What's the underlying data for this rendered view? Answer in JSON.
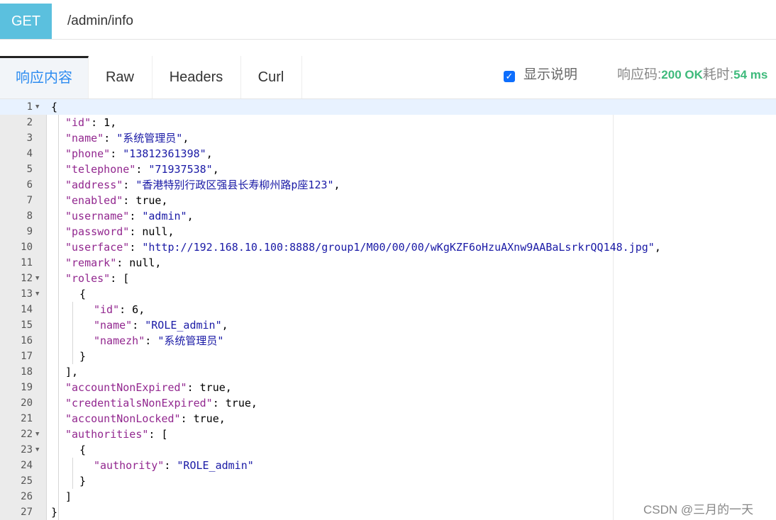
{
  "request": {
    "method": "GET",
    "url": "/admin/info"
  },
  "tabs": [
    "响应内容",
    "Raw",
    "Headers",
    "Curl"
  ],
  "options": {
    "show_desc_label": "显示说明",
    "show_desc_checked": true
  },
  "status": {
    "code_label": "响应码:",
    "code_value": "200 OK",
    "time_label": "耗时:",
    "time_value": "54 ms"
  },
  "editor": {
    "lines": [
      {
        "n": "1",
        "fold": true,
        "indent": 0,
        "parts": [
          {
            "t": "{",
            "c": "b"
          }
        ]
      },
      {
        "n": "2",
        "fold": false,
        "indent": 1,
        "parts": [
          {
            "t": "\"id\"",
            "c": "k"
          },
          {
            "t": ": 1,",
            "c": "b"
          }
        ]
      },
      {
        "n": "3",
        "fold": false,
        "indent": 1,
        "parts": [
          {
            "t": "\"name\"",
            "c": "k"
          },
          {
            "t": ": ",
            "c": "b"
          },
          {
            "t": "\"系统管理员\"",
            "c": "s"
          },
          {
            "t": ",",
            "c": "b"
          }
        ]
      },
      {
        "n": "4",
        "fold": false,
        "indent": 1,
        "parts": [
          {
            "t": "\"phone\"",
            "c": "k"
          },
          {
            "t": ": ",
            "c": "b"
          },
          {
            "t": "\"13812361398\"",
            "c": "s"
          },
          {
            "t": ",",
            "c": "b"
          }
        ]
      },
      {
        "n": "5",
        "fold": false,
        "indent": 1,
        "parts": [
          {
            "t": "\"telephone\"",
            "c": "k"
          },
          {
            "t": ": ",
            "c": "b"
          },
          {
            "t": "\"71937538\"",
            "c": "s"
          },
          {
            "t": ",",
            "c": "b"
          }
        ]
      },
      {
        "n": "6",
        "fold": false,
        "indent": 1,
        "parts": [
          {
            "t": "\"address\"",
            "c": "k"
          },
          {
            "t": ": ",
            "c": "b"
          },
          {
            "t": "\"香港特别行政区强县长寿柳州路p座123\"",
            "c": "s"
          },
          {
            "t": ",",
            "c": "b"
          }
        ]
      },
      {
        "n": "7",
        "fold": false,
        "indent": 1,
        "parts": [
          {
            "t": "\"enabled\"",
            "c": "k"
          },
          {
            "t": ": true,",
            "c": "b"
          }
        ]
      },
      {
        "n": "8",
        "fold": false,
        "indent": 1,
        "parts": [
          {
            "t": "\"username\"",
            "c": "k"
          },
          {
            "t": ": ",
            "c": "b"
          },
          {
            "t": "\"admin\"",
            "c": "s"
          },
          {
            "t": ",",
            "c": "b"
          }
        ]
      },
      {
        "n": "9",
        "fold": false,
        "indent": 1,
        "parts": [
          {
            "t": "\"password\"",
            "c": "k"
          },
          {
            "t": ": null,",
            "c": "b"
          }
        ]
      },
      {
        "n": "10",
        "fold": false,
        "indent": 1,
        "parts": [
          {
            "t": "\"userface\"",
            "c": "k"
          },
          {
            "t": ": ",
            "c": "b"
          },
          {
            "t": "\"http://192.168.10.100:8888/group1/M00/00/00/wKgKZF6oHzuAXnw9AABaLsrkrQQ148.jpg\"",
            "c": "s"
          },
          {
            "t": ",",
            "c": "b"
          }
        ]
      },
      {
        "n": "11",
        "fold": false,
        "indent": 1,
        "parts": [
          {
            "t": "\"remark\"",
            "c": "k"
          },
          {
            "t": ": null,",
            "c": "b"
          }
        ]
      },
      {
        "n": "12",
        "fold": true,
        "indent": 1,
        "parts": [
          {
            "t": "\"roles\"",
            "c": "k"
          },
          {
            "t": ": [",
            "c": "b"
          }
        ]
      },
      {
        "n": "13",
        "fold": true,
        "indent": 2,
        "parts": [
          {
            "t": "{",
            "c": "b"
          }
        ]
      },
      {
        "n": "14",
        "fold": false,
        "indent": 3,
        "parts": [
          {
            "t": "\"id\"",
            "c": "k"
          },
          {
            "t": ": 6,",
            "c": "b"
          }
        ]
      },
      {
        "n": "15",
        "fold": false,
        "indent": 3,
        "parts": [
          {
            "t": "\"name\"",
            "c": "k"
          },
          {
            "t": ": ",
            "c": "b"
          },
          {
            "t": "\"ROLE_admin\"",
            "c": "s"
          },
          {
            "t": ",",
            "c": "b"
          }
        ]
      },
      {
        "n": "16",
        "fold": false,
        "indent": 3,
        "parts": [
          {
            "t": "\"namezh\"",
            "c": "k"
          },
          {
            "t": ": ",
            "c": "b"
          },
          {
            "t": "\"系统管理员\"",
            "c": "s"
          }
        ]
      },
      {
        "n": "17",
        "fold": false,
        "indent": 2,
        "parts": [
          {
            "t": "}",
            "c": "b"
          }
        ]
      },
      {
        "n": "18",
        "fold": false,
        "indent": 1,
        "parts": [
          {
            "t": "],",
            "c": "b"
          }
        ]
      },
      {
        "n": "19",
        "fold": false,
        "indent": 1,
        "parts": [
          {
            "t": "\"accountNonExpired\"",
            "c": "k"
          },
          {
            "t": ": true,",
            "c": "b"
          }
        ]
      },
      {
        "n": "20",
        "fold": false,
        "indent": 1,
        "parts": [
          {
            "t": "\"credentialsNonExpired\"",
            "c": "k"
          },
          {
            "t": ": true,",
            "c": "b"
          }
        ]
      },
      {
        "n": "21",
        "fold": false,
        "indent": 1,
        "parts": [
          {
            "t": "\"accountNonLocked\"",
            "c": "k"
          },
          {
            "t": ": true,",
            "c": "b"
          }
        ]
      },
      {
        "n": "22",
        "fold": true,
        "indent": 1,
        "parts": [
          {
            "t": "\"authorities\"",
            "c": "k"
          },
          {
            "t": ": [",
            "c": "b"
          }
        ]
      },
      {
        "n": "23",
        "fold": true,
        "indent": 2,
        "parts": [
          {
            "t": "{",
            "c": "b"
          }
        ]
      },
      {
        "n": "24",
        "fold": false,
        "indent": 3,
        "parts": [
          {
            "t": "\"authority\"",
            "c": "k"
          },
          {
            "t": ": ",
            "c": "b"
          },
          {
            "t": "\"ROLE_admin\"",
            "c": "s"
          }
        ]
      },
      {
        "n": "25",
        "fold": false,
        "indent": 2,
        "parts": [
          {
            "t": "}",
            "c": "b"
          }
        ]
      },
      {
        "n": "26",
        "fold": false,
        "indent": 1,
        "parts": [
          {
            "t": "]",
            "c": "b"
          }
        ]
      },
      {
        "n": "27",
        "fold": false,
        "indent": 0,
        "parts": [
          {
            "t": "}",
            "c": "b"
          }
        ]
      }
    ]
  },
  "watermark": "CSDN @三月的一天",
  "colors": {
    "method_bg": "#5bc0de",
    "active_tab": "#2d8cf0",
    "status_ok": "#3fba7c",
    "json_key": "#92278f",
    "json_string": "#1a1aa6"
  }
}
